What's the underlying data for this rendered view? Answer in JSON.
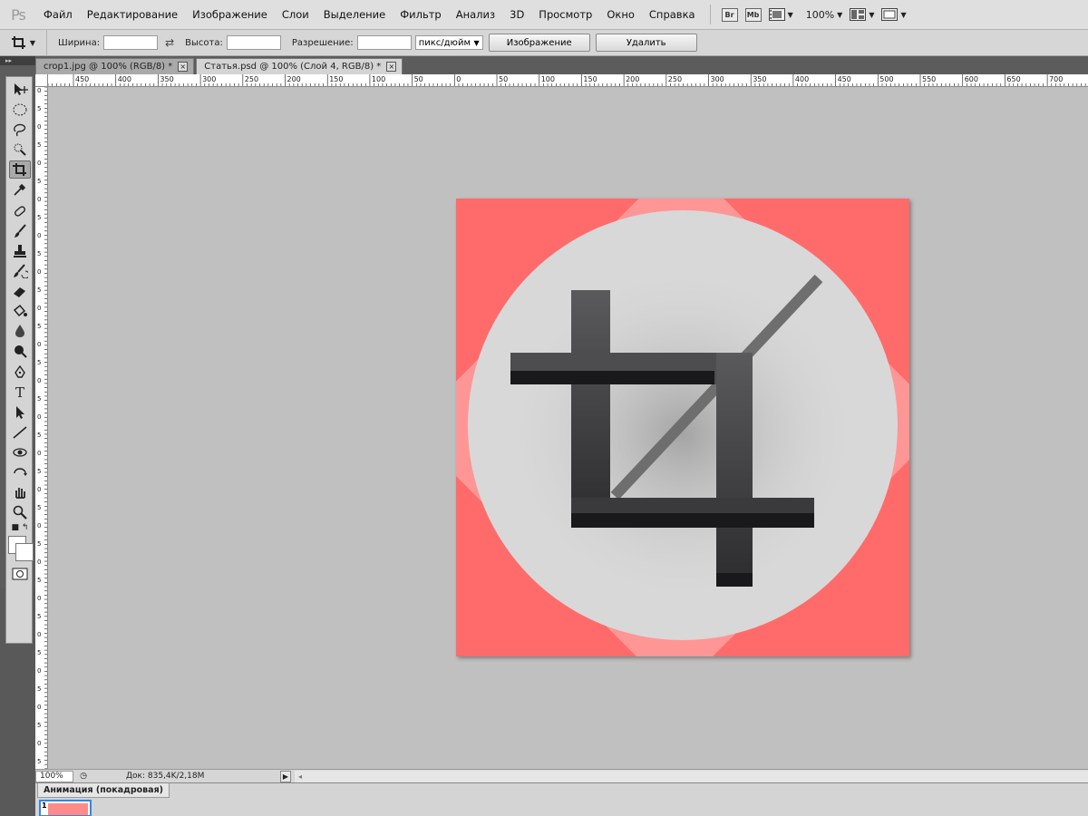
{
  "app": {
    "logo": "Ps",
    "menu": [
      "Файл",
      "Редактирование",
      "Изображение",
      "Слои",
      "Выделение",
      "Фильтр",
      "Анализ",
      "3D",
      "Просмотр",
      "Окно",
      "Справка"
    ],
    "menubar_buttons": {
      "bridge": "Br",
      "minibridge": "Mb",
      "zoom": "100%"
    }
  },
  "options_bar": {
    "width_label": "Ширина:",
    "width_value": "",
    "height_label": "Высота:",
    "height_value": "",
    "resolution_label": "Разрешение:",
    "resolution_value": "",
    "resolution_unit": "пикс/дюйм",
    "front_image_button": "Изображение",
    "clear_button": "Удалить"
  },
  "tabs": [
    {
      "label": "crop1.jpg @ 100% (RGB/8) *",
      "active": false
    },
    {
      "label": "Статья.psd @ 100% (Слой 4, RGB/8) *",
      "active": true
    }
  ],
  "ruler": {
    "h_ticks": [
      "450",
      "400",
      "350",
      "300",
      "250",
      "200",
      "150",
      "100",
      "50",
      "0",
      "50",
      "100",
      "150",
      "200",
      "250",
      "300",
      "350",
      "400",
      "450",
      "500",
      "550",
      "600",
      "650",
      "700"
    ],
    "v_ticks": [
      "0",
      "5",
      "0",
      "5",
      "0",
      "5",
      "0",
      "5",
      "0",
      "5",
      "0",
      "5",
      "0",
      "5",
      "0",
      "5",
      "0",
      "5",
      "0",
      "5",
      "0",
      "5",
      "0",
      "5",
      "0",
      "5",
      "0",
      "5",
      "0",
      "5",
      "0",
      "5",
      "0",
      "5",
      "0",
      "5",
      "0",
      "5"
    ]
  },
  "document": {
    "background_color": "#ff9696",
    "accent_color": "#ff6b6b",
    "circle_color": "#d8d8d8",
    "icon_color": "#3a3a3c",
    "line_color": "#6e6e6e"
  },
  "status": {
    "zoom": "100%",
    "doc_info": "Док: 835,4K/2,18M"
  },
  "animation_panel": {
    "title": "Анимация (покадровая)",
    "frame_number": "1"
  }
}
